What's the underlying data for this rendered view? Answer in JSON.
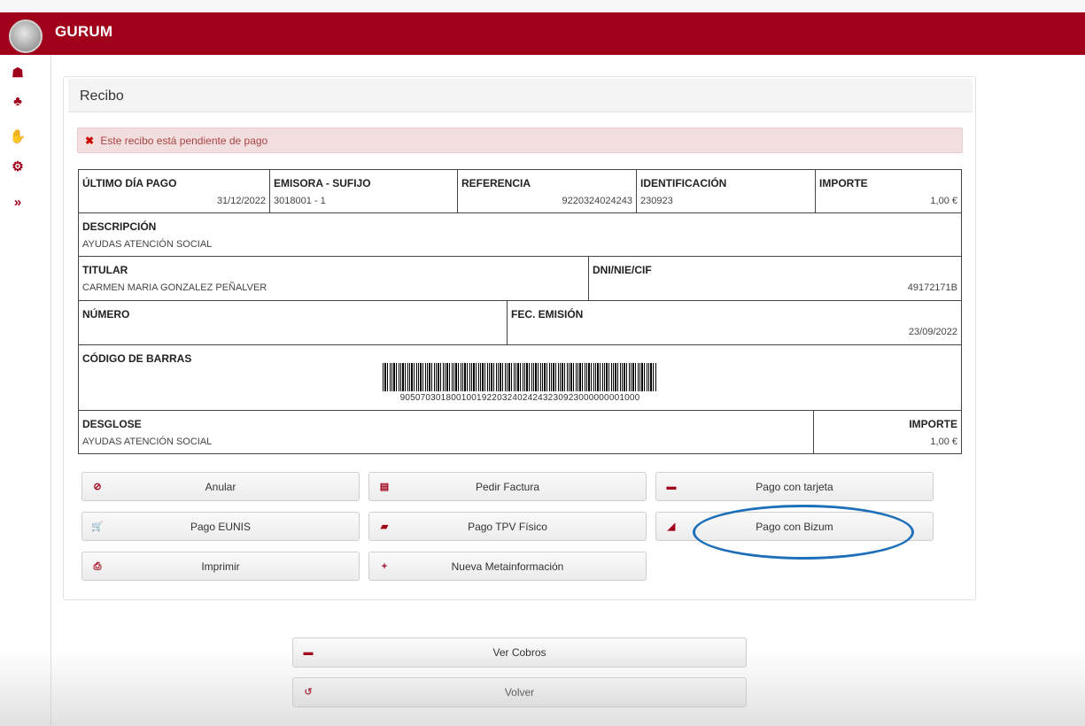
{
  "app": {
    "name": "GURUM"
  },
  "sidebar": {
    "items": [
      {
        "icon": "home-icon",
        "glyph": "☗"
      },
      {
        "icon": "sitemap-icon",
        "glyph": "♣"
      },
      {
        "icon": "handshake-icon",
        "glyph": "✋"
      },
      {
        "icon": "gears-icon",
        "glyph": "⚙"
      },
      {
        "icon": "expand-icon",
        "glyph": "»"
      }
    ]
  },
  "page": {
    "title": "Recibo"
  },
  "alert": {
    "icon": "✖",
    "text": "Este recibo está pendiente de pago"
  },
  "receipt": {
    "ultimo_dia_pago": {
      "label": "ÚLTIMO DÍA PAGO",
      "value": "31/12/2022"
    },
    "emisora": {
      "label": "EMISORA - SUFIJO",
      "value": "3018001 - 1"
    },
    "referencia": {
      "label": "REFERENCIA",
      "value": "9220324024243"
    },
    "identificacion": {
      "label": "IDENTIFICACIÓN",
      "value": "230923"
    },
    "importe": {
      "label": "IMPORTE",
      "value": "1,00 €"
    },
    "descripcion": {
      "label": "DESCRIPCIÓN",
      "value": "AYUDAS ATENCIÓN SOCIAL"
    },
    "titular": {
      "label": "TITULAR",
      "value": "CARMEN MARIA GONZALEZ PEÑALVER"
    },
    "dni": {
      "label": "DNI/NIE/CIF",
      "value": "49172171B"
    },
    "numero": {
      "label": "NÚMERO",
      "value": ""
    },
    "fec_emision": {
      "label": "FEC. EMISIÓN",
      "value": "23/09/2022"
    },
    "codigo_barras": {
      "label": "CÓDIGO DE BARRAS",
      "value": "90507030180010019220324024243230923000000001000"
    },
    "desglose": {
      "label": "DESGLOSE",
      "value": "AYUDAS ATENCIÓN SOCIAL"
    },
    "desglose_importe": {
      "label": "IMPORTE",
      "value": "1,00 €"
    }
  },
  "actions": {
    "anular": {
      "label": "Anular",
      "icon": "⊘"
    },
    "pedir_factura": {
      "label": "Pedir Factura",
      "icon": "▤"
    },
    "pago_tarjeta": {
      "label": "Pago con tarjeta",
      "icon": "▬"
    },
    "pago_eunis": {
      "label": "Pago EUNIS",
      "icon": "🛒"
    },
    "pago_tpv": {
      "label": "Pago TPV Físico",
      "icon": "▰"
    },
    "pago_bizum": {
      "label": "Pago con Bizum",
      "icon": "◢"
    },
    "imprimir": {
      "label": "Imprimir",
      "icon": "⎙"
    },
    "nueva_meta": {
      "label": "Nueva Metainformación",
      "icon": "+"
    }
  },
  "footer_actions": {
    "ver_cobros": {
      "label": "Ver Cobros",
      "icon": "▬"
    },
    "volver": {
      "label": "Volver",
      "icon": "↺"
    }
  },
  "colors": {
    "brand": "#a1001a",
    "alert_bg": "#f2dede",
    "highlight": "#1c6fb8"
  }
}
